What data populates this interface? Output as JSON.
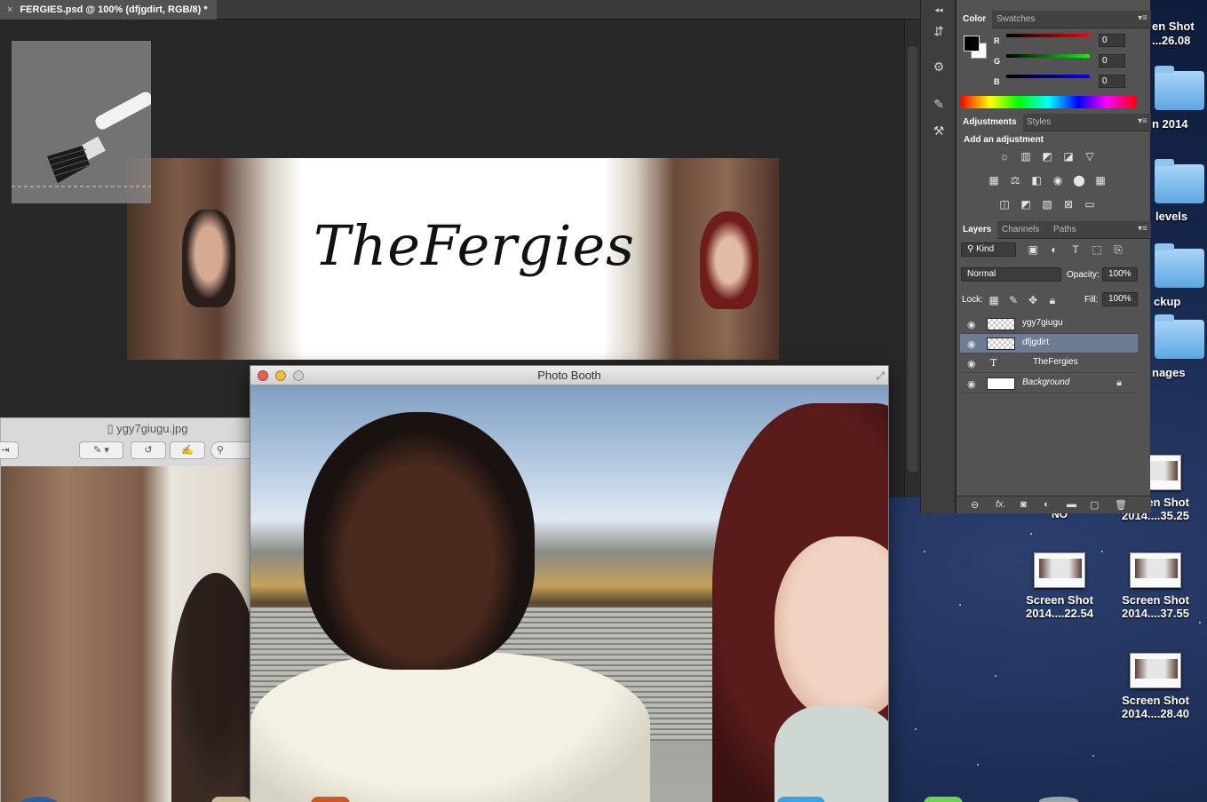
{
  "photoshop": {
    "document_tab": "FERGIES.psd @ 100% (dfjgdirt, RGB/8) *",
    "close_glyph": "×",
    "banner_text": "TheFergies",
    "color_panel": {
      "tabs": [
        "Color",
        "Swatches"
      ],
      "channels": [
        {
          "label": "R",
          "value": "0"
        },
        {
          "label": "G",
          "value": "0"
        },
        {
          "label": "B",
          "value": "0"
        }
      ]
    },
    "adjustments_panel": {
      "tabs": [
        "Adjustments",
        "Styles"
      ],
      "title": "Add an adjustment"
    },
    "layers_panel": {
      "tabs": [
        "Layers",
        "Channels",
        "Paths"
      ],
      "filter_kind": "Kind",
      "blend_mode": "Normal",
      "opacity_label": "Opacity:",
      "opacity_value": "100%",
      "lock_label": "Lock:",
      "fill_label": "Fill:",
      "fill_value": "100%",
      "layers": [
        {
          "name": "ygy7giugu",
          "type": "image",
          "selected": false
        },
        {
          "name": "dfjgdirt",
          "type": "image",
          "selected": true
        },
        {
          "name": "TheFergies",
          "type": "text",
          "selected": false
        },
        {
          "name": "Background",
          "type": "background",
          "selected": false,
          "locked": true
        }
      ]
    }
  },
  "preview_window": {
    "title": "ygy7giugu.jpg"
  },
  "photo_booth": {
    "title": "Photo Booth"
  },
  "desktop": {
    "partial_labels": [
      "en Shot",
      "...26.08",
      "n 2014",
      "levels",
      "ckup",
      "nages",
      "NO"
    ],
    "icons": [
      {
        "line1": "Screen Shot",
        "line2": "2014....35.25"
      },
      {
        "line1": "Screen Shot",
        "line2": "2014....22.54"
      },
      {
        "line1": "Screen Shot",
        "line2": "2014....37.55"
      },
      {
        "line1": "Screen Shot",
        "line2": "2014....28.40"
      }
    ]
  },
  "colors": {
    "ps_bg": "#282828",
    "ps_panel": "#535353",
    "layer_selected": "#6d7b93"
  }
}
